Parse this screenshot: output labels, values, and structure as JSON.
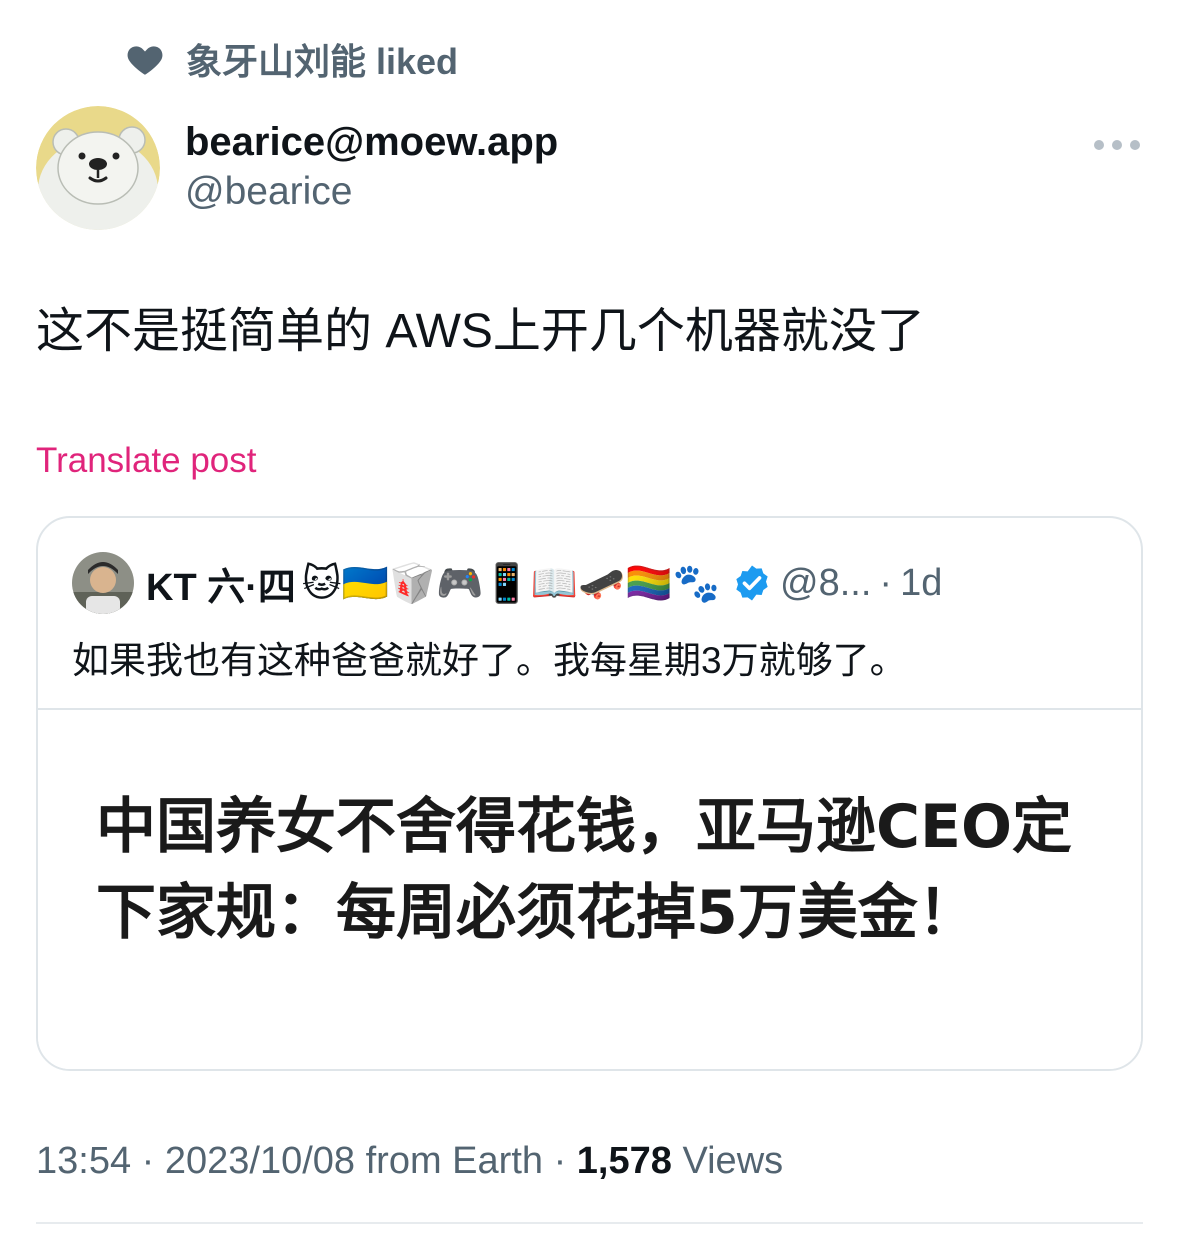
{
  "social_context": {
    "icon": "heart-icon",
    "text": "象牙山刘能 liked"
  },
  "author": {
    "display_name": "bearice@moew.app",
    "handle": "@bearice",
    "avatar": "polar-bear-avatar"
  },
  "post": {
    "text": "这不是挺简单的 AWS上开几个机器就没了",
    "translate_label": "Translate post"
  },
  "quoted_post": {
    "display_name": "KT 六·四",
    "name_emojis": "🐱🇺🇦🥡🎮📱📖🛹🏳️‍🌈🐾",
    "verified": true,
    "handle": "@8...",
    "separator": "·",
    "time": "1d",
    "text": "如果我也有这种爸爸就好了。我每星期3万就够了。",
    "media_headline": "中国养女不舍得花钱，亚马逊CEO定下家规：每周必须花掉5万美金！"
  },
  "meta": {
    "time": "13:54",
    "date": "2023/10/08",
    "source": "from Earth",
    "separator": "·",
    "views_count": "1,578",
    "views_label": "Views"
  },
  "colors": {
    "accent_pink": "#e0247b",
    "secondary_text": "#536471",
    "primary_text": "#0f1419",
    "verified_blue": "#1d9bf0",
    "border": "#dfe5e9"
  }
}
